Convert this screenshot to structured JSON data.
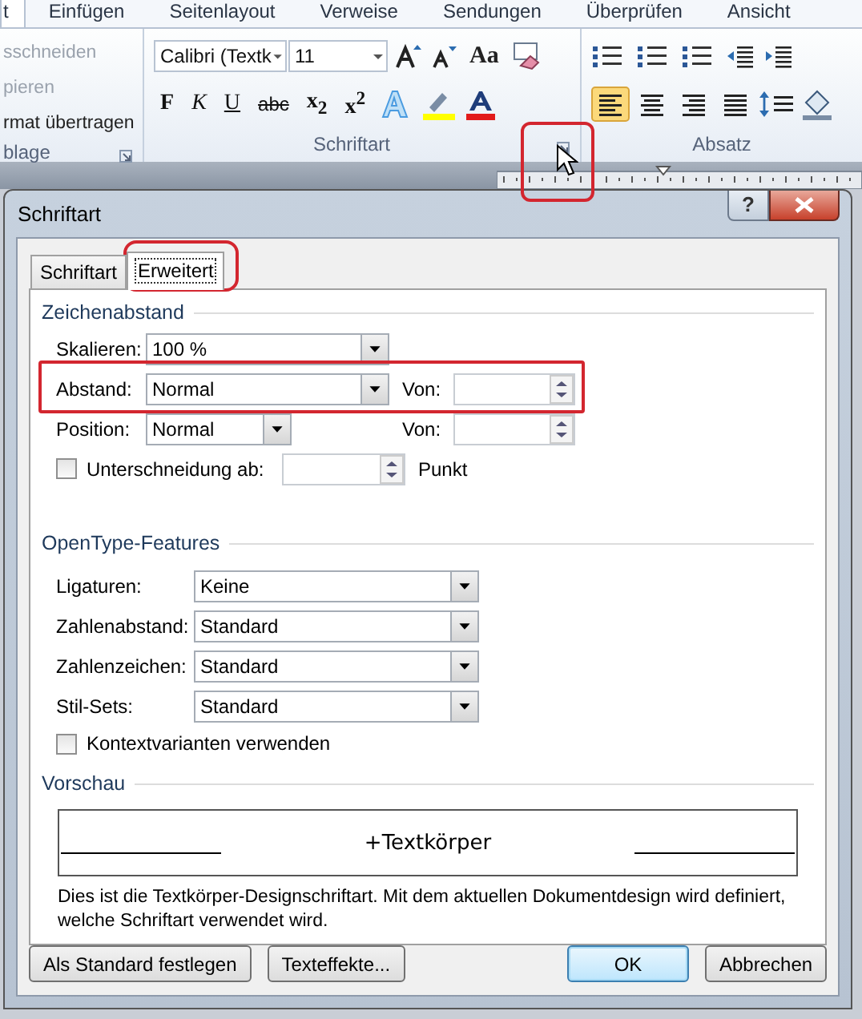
{
  "ribbon": {
    "tabs": [
      {
        "label": "t",
        "selected": true
      },
      {
        "label": "Einfügen",
        "selected": false
      },
      {
        "label": "Seitenlayout",
        "selected": false
      },
      {
        "label": "Verweise",
        "selected": false
      },
      {
        "label": "Sendungen",
        "selected": false
      },
      {
        "label": "Überprüfen",
        "selected": false
      },
      {
        "label": "Ansicht",
        "selected": false
      }
    ],
    "clipboard": {
      "items": [
        {
          "label": "sschneiden",
          "disabled": true
        },
        {
          "label": "pieren",
          "disabled": true
        },
        {
          "label": "rmat übertragen",
          "disabled": false
        }
      ],
      "label": "blage"
    },
    "font_group": {
      "font": "Calibri (Textk",
      "size": "11",
      "label": "Schriftart",
      "case_button": "Aa",
      "format_buttons": [
        {
          "label": "F",
          "kind": "bold"
        },
        {
          "label": "K",
          "kind": "italic"
        },
        {
          "label": "U",
          "kind": "underline"
        },
        {
          "label": "abc",
          "kind": "strike"
        },
        {
          "label": "x$_{2}$",
          "kind": "script"
        },
        {
          "label": "x$^{2}$",
          "kind": "script"
        }
      ],
      "launcher_highlighted": true
    },
    "paragraph_group": {
      "label": "Absatz"
    }
  },
  "dialog": {
    "title": "Schriftart",
    "help": "?",
    "tabs": [
      {
        "label": "Schriftart",
        "selected": false,
        "highlighted": false
      },
      {
        "label": "Erweitert",
        "selected": true,
        "highlighted": true
      }
    ],
    "spacing_section": {
      "heading": "Zeichenabstand",
      "scale": {
        "label": "Skalieren:",
        "value": "100 %"
      },
      "spacing": {
        "label": "Abstand:",
        "value": "Normal",
        "by_label": "Von:",
        "highlighted": true
      },
      "position": {
        "label": "Position:",
        "value": "Normal",
        "by_label": "Von:"
      },
      "kerning": {
        "label": "Unterschneidung ab:",
        "checked": false,
        "unit": "Punkt"
      }
    },
    "opentype_section": {
      "heading": "OpenType-Features",
      "rows": [
        {
          "label": "Ligaturen:",
          "value": "Keine"
        },
        {
          "label": "Zahlenabstand:",
          "value": "Standard"
        },
        {
          "label": "Zahlenzeichen:",
          "value": "Standard"
        },
        {
          "label": "Stil-Sets:",
          "value": "Standard"
        }
      ],
      "contextual": {
        "label": "Kontextvarianten verwenden",
        "checked": false
      }
    },
    "preview_section": {
      "heading": "Vorschau",
      "sample": "+Textkörper",
      "description": "Dies ist die Textkörper-Designschriftart. Mit dem aktuellen Dokumentdesign wird definiert, welche Schriftart verwendet wird."
    },
    "buttons": [
      {
        "label": "Als Standard festlegen",
        "kind": "left",
        "default": false
      },
      {
        "label": "Texteffekte...",
        "kind": "left",
        "default": false
      },
      {
        "label": "OK",
        "kind": "right",
        "default": true
      },
      {
        "label": "Abbrechen",
        "kind": "right",
        "default": false
      }
    ]
  }
}
